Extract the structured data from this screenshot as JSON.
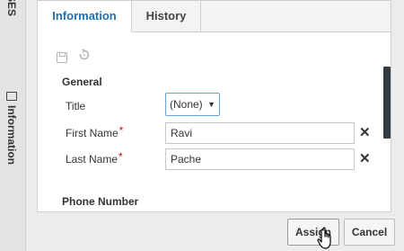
{
  "sidebar": {
    "top_label": "SES",
    "info_label": "Information"
  },
  "tabs": [
    {
      "label": "Information",
      "active": true
    },
    {
      "label": "History",
      "active": false
    }
  ],
  "toolbar": {
    "icons": [
      "save-icon",
      "reset-icon"
    ]
  },
  "sections": {
    "general": "General",
    "phone": "Phone Number"
  },
  "form": {
    "title": {
      "label": "Title",
      "value": "(None)"
    },
    "first_name": {
      "label": "First Name",
      "required": "*",
      "value": "Ravi"
    },
    "last_name": {
      "label": "Last Name",
      "required": "*",
      "value": "Pache"
    }
  },
  "buttons": {
    "assign": "Assign",
    "cancel": "Cancel"
  },
  "colors": {
    "active_tab": "#1f6fb2",
    "required": "#d0021b"
  }
}
